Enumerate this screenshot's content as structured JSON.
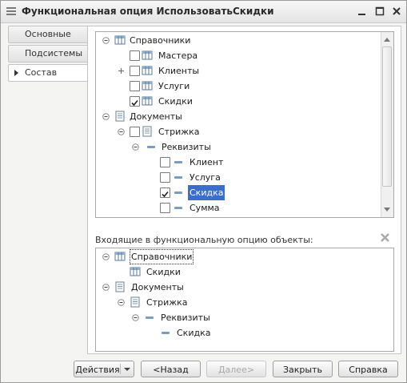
{
  "window": {
    "title": "Функциональная опция ИспользоватьСкидки"
  },
  "tabs": [
    {
      "label": "Основные"
    },
    {
      "label": "Подсистемы"
    },
    {
      "label": "Состав"
    }
  ],
  "composition_tree": {
    "rows": [
      {
        "label": "Справочники",
        "checked": null,
        "expander": "collapse"
      },
      {
        "label": "Мастера",
        "checked": false,
        "expander": null
      },
      {
        "label": "Клиенты",
        "checked": false,
        "expander": "expand"
      },
      {
        "label": "Услуги",
        "checked": false,
        "expander": null
      },
      {
        "label": "Скидки",
        "checked": true,
        "expander": null
      },
      {
        "label": "Документы",
        "checked": null,
        "expander": "collapse"
      },
      {
        "label": "Стрижка",
        "checked": false,
        "expander": "collapse"
      },
      {
        "label": "Реквизиты",
        "checked": null,
        "expander": "collapse"
      },
      {
        "label": "Клиент",
        "checked": false,
        "expander": null
      },
      {
        "label": "Услуга",
        "checked": false,
        "expander": null
      },
      {
        "label": "Скидка",
        "checked": true,
        "expander": null,
        "selected": true
      },
      {
        "label": "Сумма",
        "checked": false,
        "expander": null
      }
    ]
  },
  "included": {
    "label": "Входящие в функциональную опцию объекты:",
    "rows": [
      {
        "label": "Справочники"
      },
      {
        "label": "Скидки"
      },
      {
        "label": "Документы"
      },
      {
        "label": "Стрижка"
      },
      {
        "label": "Реквизиты"
      },
      {
        "label": "Скидка"
      }
    ]
  },
  "buttons": {
    "actions": "Действия",
    "back": "<Назад",
    "next": "Далее>",
    "close": "Закрыть",
    "help": "Справка"
  },
  "colors": {
    "selection": "#3a6ec8",
    "accent": "#2a5aa8"
  }
}
